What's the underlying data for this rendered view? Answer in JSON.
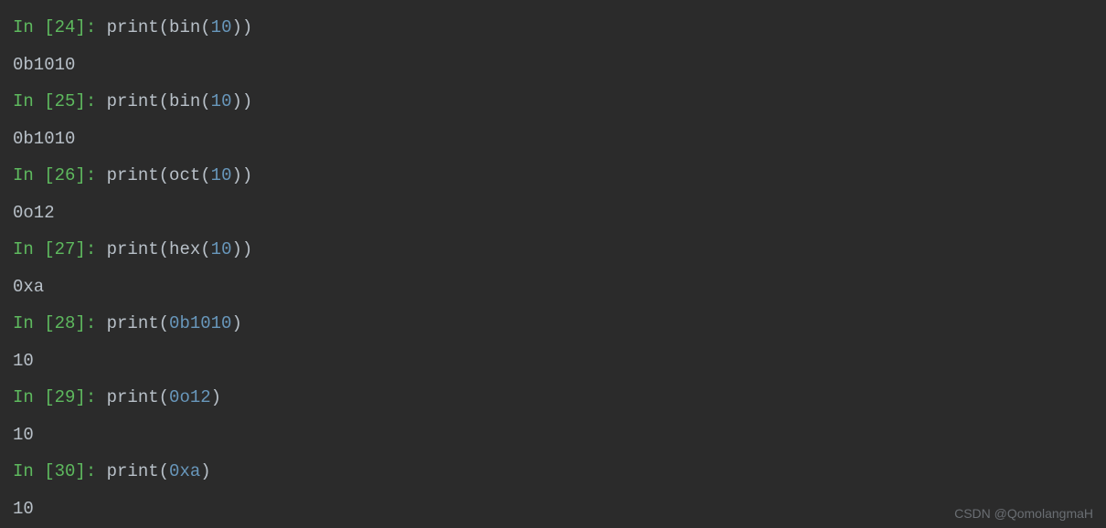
{
  "cells": [
    {
      "prompt": "In [24]: ",
      "fn": "print",
      "op": "(",
      "inner_fn": "bin",
      "inner_op": "(",
      "arg": "10",
      "inner_cp": ")",
      "cp": ")",
      "output": "0b1010"
    },
    {
      "prompt": "In [25]: ",
      "fn": "print",
      "op": "(",
      "inner_fn": "bin",
      "inner_op": "(",
      "arg": "10",
      "inner_cp": ")",
      "cp": ")",
      "output": "0b1010"
    },
    {
      "prompt": "In [26]: ",
      "fn": "print",
      "op": "(",
      "inner_fn": "oct",
      "inner_op": "(",
      "arg": "10",
      "inner_cp": ")",
      "cp": ")",
      "output": "0o12"
    },
    {
      "prompt": "In [27]: ",
      "fn": "print",
      "op": "(",
      "inner_fn": "hex",
      "inner_op": "(",
      "arg": "10",
      "inner_cp": ")",
      "cp": ")",
      "output": "0xa"
    },
    {
      "prompt": "In [28]: ",
      "fn": "print",
      "op": "(",
      "inner_fn": "",
      "inner_op": "",
      "arg": "0b1010",
      "inner_cp": "",
      "cp": ")",
      "output": "10"
    },
    {
      "prompt": "In [29]: ",
      "fn": "print",
      "op": "(",
      "inner_fn": "",
      "inner_op": "",
      "arg": "0o12",
      "inner_cp": "",
      "cp": ")",
      "output": "10"
    },
    {
      "prompt": "In [30]: ",
      "fn": "print",
      "op": "(",
      "inner_fn": "",
      "inner_op": "",
      "arg": "0xa",
      "inner_cp": "",
      "cp": ")",
      "output": "10"
    }
  ],
  "watermark": "CSDN @QomolangmaH"
}
